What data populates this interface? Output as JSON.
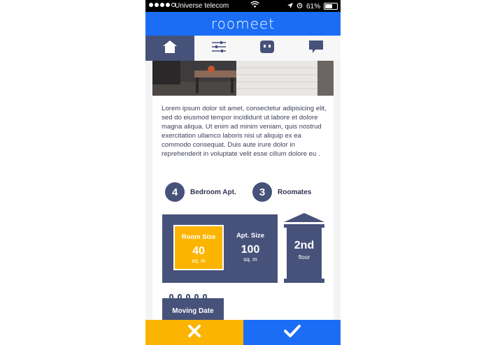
{
  "status_bar": {
    "carrier": "Universe telecom",
    "battery": "61%",
    "battery_level": 0.61,
    "signal_bars": 4
  },
  "app": {
    "title": "roomeet",
    "accent_color": "#1a6df4",
    "navy_color": "#47527a",
    "yellow_color": "#fbb400"
  },
  "tabs": [
    {
      "icon": "home-icon",
      "active": true
    },
    {
      "icon": "sliders-icon",
      "active": false
    },
    {
      "icon": "robot-face-icon",
      "active": false
    },
    {
      "icon": "chat-bubble-icon",
      "active": false
    }
  ],
  "listing": {
    "description": "Lorem ipsum dolor sit amet, consectetur adipisicing elit,  sed do eiusmod tempor incididunt ut labore et dolore magna aliqua. Ut enim ad minim veniam, quis nostrud exercitation ullamco laboris nisi ut aliquip ex ea commodo consequat. Duis aute irure dolor in reprehenderit in voluptate velit esse cillum dolore eu .",
    "bedrooms": {
      "number": "4",
      "label": "Bedroom Apt."
    },
    "roommates": {
      "number": "3",
      "label": "Roomates"
    },
    "room_size": {
      "title": "Room Size",
      "value": "40",
      "unit": "sq. m"
    },
    "apt_size": {
      "title": "Apt. Size",
      "value": "100",
      "unit": "sq. m"
    },
    "floor": {
      "value": "2nd",
      "label": "floor"
    },
    "moving_date": {
      "title": "Moving Date"
    }
  },
  "actions": {
    "reject_icon": "close-x-icon",
    "accept_icon": "checkmark-icon"
  }
}
